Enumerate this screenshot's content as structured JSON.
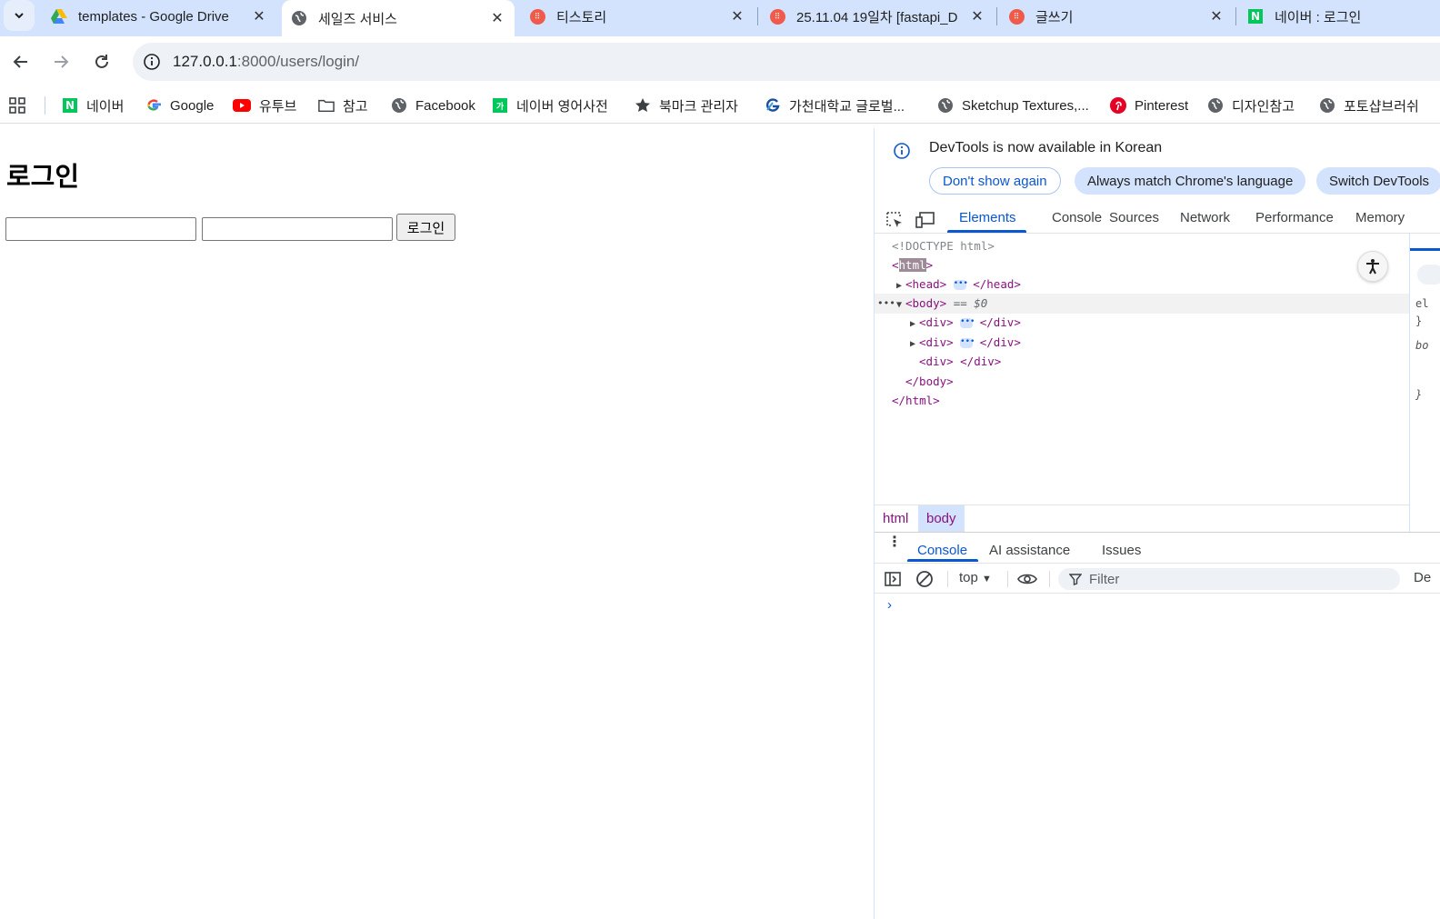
{
  "tabs": [
    {
      "title": "templates - Google Drive",
      "icon": "google-drive-icon"
    },
    {
      "title": "세일즈 서비스",
      "icon": "globe-icon",
      "active": true
    },
    {
      "title": "티스토리",
      "icon": "tistory-icon"
    },
    {
      "title": "25.11.04 19일차 [fastapi_D",
      "icon": "tistory-icon"
    },
    {
      "title": "글쓰기",
      "icon": "tistory-icon"
    },
    {
      "title": "네이버 : 로그인",
      "icon": "naver-icon"
    }
  ],
  "address": {
    "host": "127.0.0.1",
    "path": ":8000/users/login/"
  },
  "bookmarks": [
    {
      "label": "네이버",
      "icon": "naver-icon"
    },
    {
      "label": "Google",
      "icon": "google-icon"
    },
    {
      "label": "유투브",
      "icon": "youtube-icon"
    },
    {
      "label": "참고",
      "icon": "folder-icon"
    },
    {
      "label": "Facebook",
      "icon": "globe-icon"
    },
    {
      "label": "네이버 영어사전",
      "icon": "naver-dict-icon"
    },
    {
      "label": "북마크 관리자",
      "icon": "star-icon"
    },
    {
      "label": "가천대학교 글로벌...",
      "icon": "gachon-icon"
    },
    {
      "label": "Sketchup Textures,...",
      "icon": "globe-icon"
    },
    {
      "label": "Pinterest",
      "icon": "pinterest-icon"
    },
    {
      "label": "디자인참고",
      "icon": "globe-icon"
    },
    {
      "label": "포토샵브러쉬",
      "icon": "globe-icon"
    }
  ],
  "page": {
    "heading": "로그인",
    "login_button": "로그인"
  },
  "devtools": {
    "infobar": {
      "message": "DevTools is now available in Korean",
      "dont_show": "Don't show again",
      "always_match": "Always match Chrome's language",
      "switch": "Switch DevTools"
    },
    "tabs": [
      "Elements",
      "Console",
      "Sources",
      "Network",
      "Performance",
      "Memory"
    ],
    "active_tab": "Elements",
    "dom": {
      "doctype": "<!DOCTYPE html>",
      "html_open_lt": "<",
      "html_name": "html",
      "html_open_gt": ">",
      "head_open": "<head>",
      "head_close": "</head>",
      "body_open": "<body>",
      "body_ref": "== $0",
      "div_open": "<div>",
      "div_close": "</div>",
      "div_empty": "<div> </div>",
      "body_close": "</body>",
      "html_close": "</html>"
    },
    "side_pane": {
      "lines": [
        "el",
        "}",
        "bo",
        "}"
      ]
    },
    "breadcrumbs": [
      "html",
      "body"
    ],
    "drawer_tabs": [
      "Console",
      "AI assistance",
      "Issues"
    ],
    "console": {
      "context": "top",
      "filter_placeholder": "Filter",
      "levels": "De",
      "prompt": "›"
    }
  },
  "colors": {
    "tabstrip": "#d3e3fd",
    "accent": "#0b57d0",
    "tag": "#881280"
  }
}
